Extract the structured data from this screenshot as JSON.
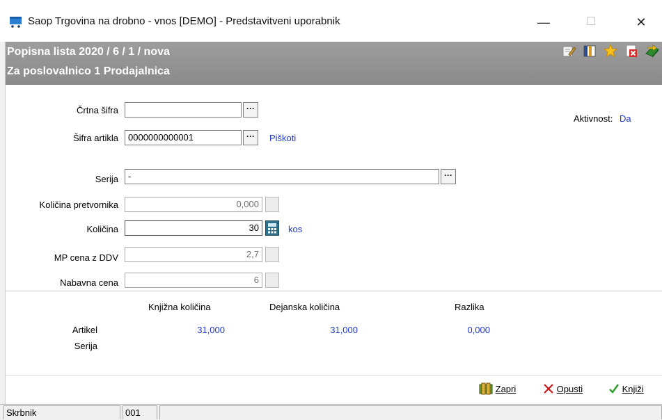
{
  "window": {
    "title": "Saop Trgovina na drobno - vnos [DEMO] - Predstavitveni uporabnik",
    "minimize": "—",
    "maximize": "☐",
    "close": "✕"
  },
  "header": {
    "line1": "Popisna lista 2020 / 6 / 1 / nova",
    "line2": "Za poslovalnico 1 Prodajalnica",
    "toolbar_icons": [
      "edit-icon",
      "columns-icon",
      "star-icon",
      "delete-document-icon",
      "book-exit-icon"
    ]
  },
  "form": {
    "barcode": {
      "label": "Črtna šifra",
      "value": ""
    },
    "article_code": {
      "label": "Šifra artikla",
      "value": "0000000000001",
      "description": "Piškoti"
    },
    "activity": {
      "label": "Aktivnost:",
      "value": "Da"
    },
    "series": {
      "label": "Serija",
      "value": "-"
    },
    "converter_qty": {
      "label": "Količina pretvornika",
      "value": "0,000"
    },
    "quantity": {
      "label": "Količina",
      "value": "30",
      "unit": "kos"
    },
    "retail_price": {
      "label": "MP cena z DDV",
      "value": "2,7"
    },
    "purchase_price": {
      "label": "Nabavna cena",
      "value": "6"
    },
    "dots": "···"
  },
  "summary": {
    "headers": [
      "Knjižna količina",
      "Dejanska količina",
      "Razlika"
    ],
    "rows": [
      {
        "label": "Artikel",
        "values": [
          "31,000",
          "31,000",
          "0,000"
        ]
      },
      {
        "label": "Serija",
        "values": [
          "",
          "",
          ""
        ]
      }
    ]
  },
  "buttons": {
    "close": "Zapri",
    "cancel": "Opusti",
    "post": "Knjiži"
  },
  "status": {
    "user": "Skrbnik",
    "code": "001"
  },
  "colors": {
    "header_bg": "#8f8f8f",
    "value_blue": "#1f37cc"
  }
}
